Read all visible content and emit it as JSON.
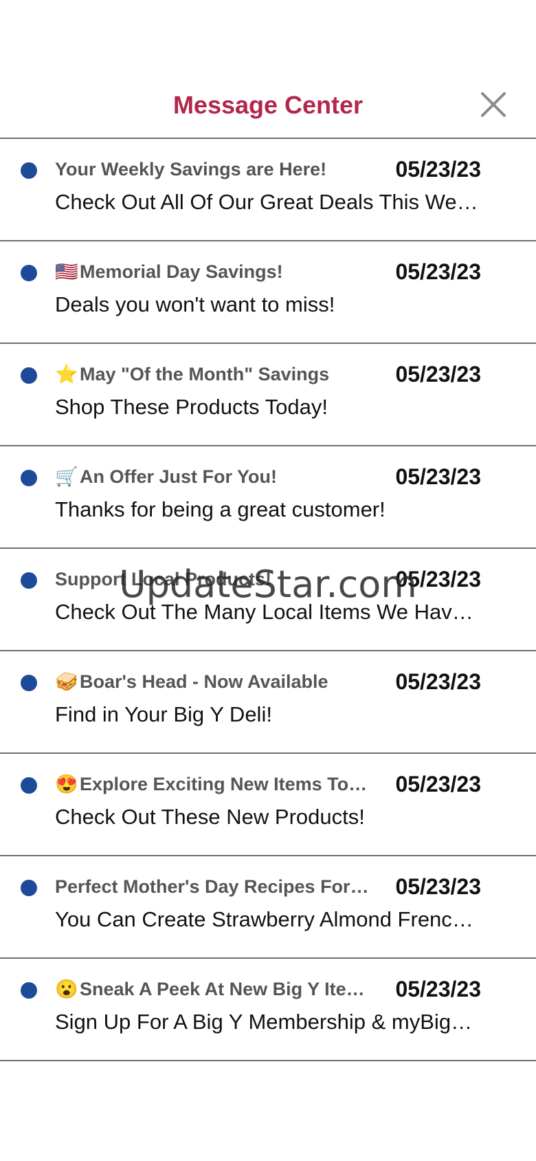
{
  "header": {
    "title": "Message Center",
    "close_icon": "close-icon"
  },
  "colors": {
    "title": "#b3264a",
    "unread_dot": "#1d4b9a",
    "divider": "#6e6e6e"
  },
  "messages": [
    {
      "emoji": "",
      "title": "Your Weekly Savings are Here!",
      "date": "05/23/23",
      "body": "Check Out All Of Our Great Deals This Week!"
    },
    {
      "emoji": "🇺🇸",
      "title": "Memorial Day Savings!",
      "date": "05/23/23",
      "body": "Deals you won't want to miss!"
    },
    {
      "emoji": "⭐",
      "title": "May \"Of the Month\" Savings",
      "date": "05/23/23",
      "body": "Shop These Products Today!"
    },
    {
      "emoji": "🛒",
      "title": "An Offer Just For You!",
      "date": "05/23/23",
      "body": "Thanks for being a great customer!"
    },
    {
      "emoji": "",
      "title": "Support Local Products!",
      "date": "05/23/23",
      "body": "Check Out The Many Local Items We Have Available!"
    },
    {
      "emoji": "🥪",
      "title": "Boar's Head - Now Available",
      "date": "05/23/23",
      "body": "Find in Your Big Y Deli!"
    },
    {
      "emoji": "😍",
      "title": "Explore Exciting New Items Today",
      "date": "05/23/23",
      "body": "Check Out These New Products!"
    },
    {
      "emoji": "",
      "title": "Perfect Mother's Day Recipes For You",
      "date": "05/23/23",
      "body": "You Can Create Strawberry Almond French Toast"
    },
    {
      "emoji": "😮",
      "title": "Sneak A Peek At New Big Y Items",
      "date": "05/23/23",
      "body": "Sign Up For A Big Y Membership & myBigY Rewards"
    }
  ],
  "watermark": "UpdateStar.com"
}
